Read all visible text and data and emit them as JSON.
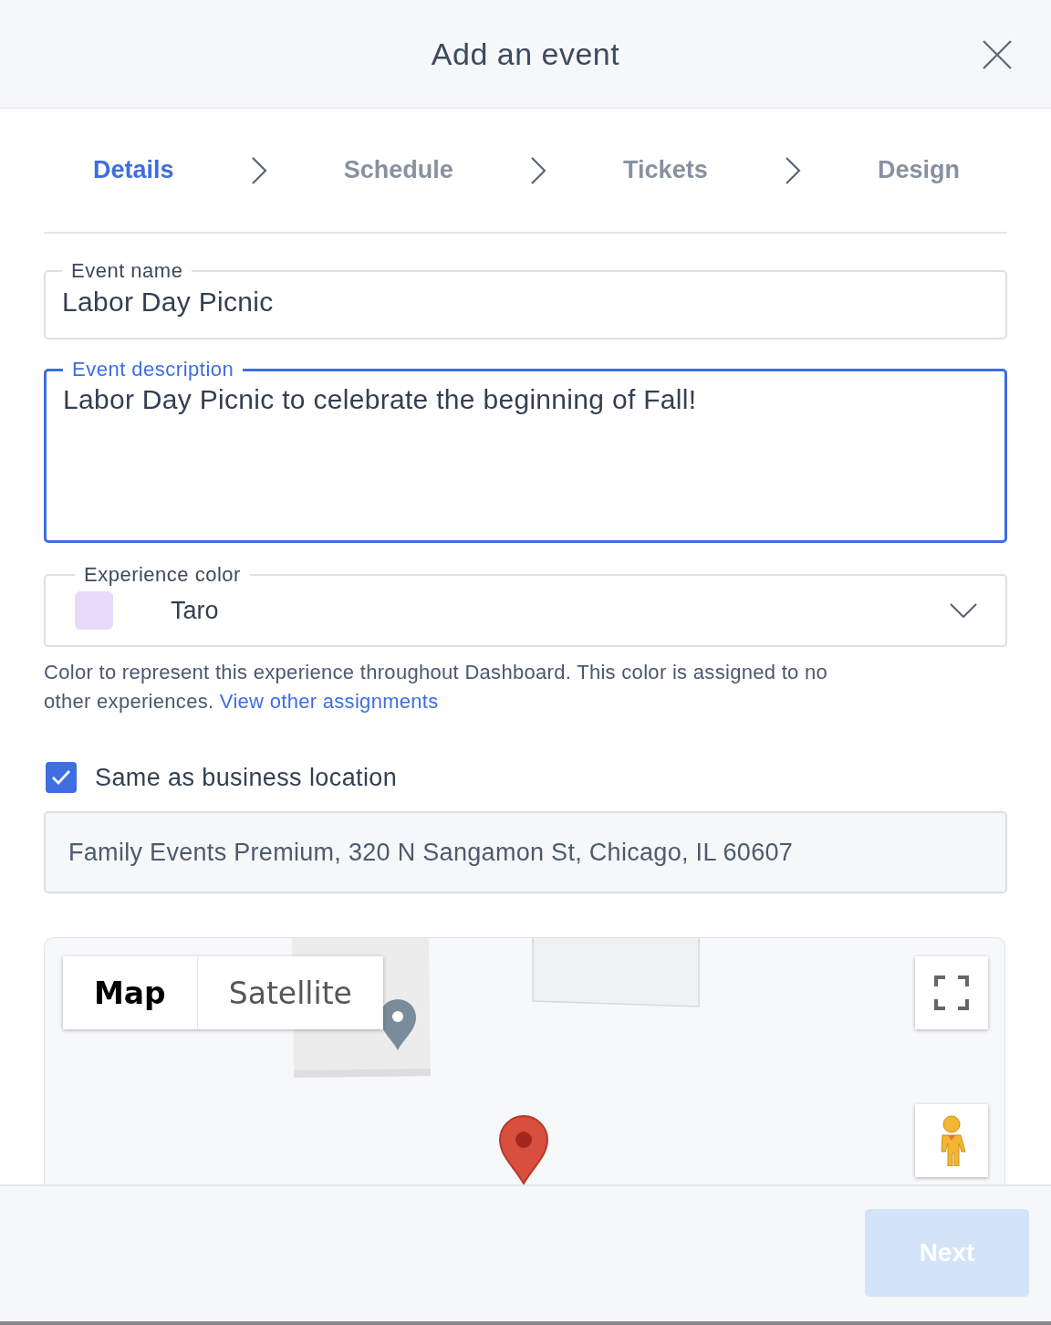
{
  "dialog": {
    "title": "Add an event"
  },
  "steps": [
    {
      "label": "Details",
      "selected": true
    },
    {
      "label": "Schedule",
      "selected": false
    },
    {
      "label": "Tickets",
      "selected": false
    },
    {
      "label": "Design",
      "selected": false
    }
  ],
  "fields": [
    {
      "kind": "input",
      "label": "Event name",
      "value": "Labor Day Picnic",
      "focused": false
    },
    {
      "kind": "textarea",
      "label": "Event description",
      "value": "Labor Day Picnic to celebrate the beginning of Fall!",
      "focused": true
    }
  ],
  "experience_color": {
    "label": "Experience color",
    "value": "Taro",
    "color": "#e8dbf9"
  },
  "help_text": {
    "text": "Color to represent this experience throughout Dashboard. This color is assigned to no other experiences.",
    "link": "View other assignments"
  },
  "same_location": {
    "label": "Same as business location",
    "checked": true
  },
  "address": {
    "value": "Family Events Premium, 320 N Sangamon St, Chicago, IL 60607",
    "disabled": true
  },
  "map": {
    "type_buttons": [
      {
        "label": "Map",
        "selected": true
      },
      {
        "label": "Satellite",
        "selected": false
      }
    ]
  },
  "footer": {
    "next_button": {
      "label": "Next",
      "disabled": true
    }
  }
}
